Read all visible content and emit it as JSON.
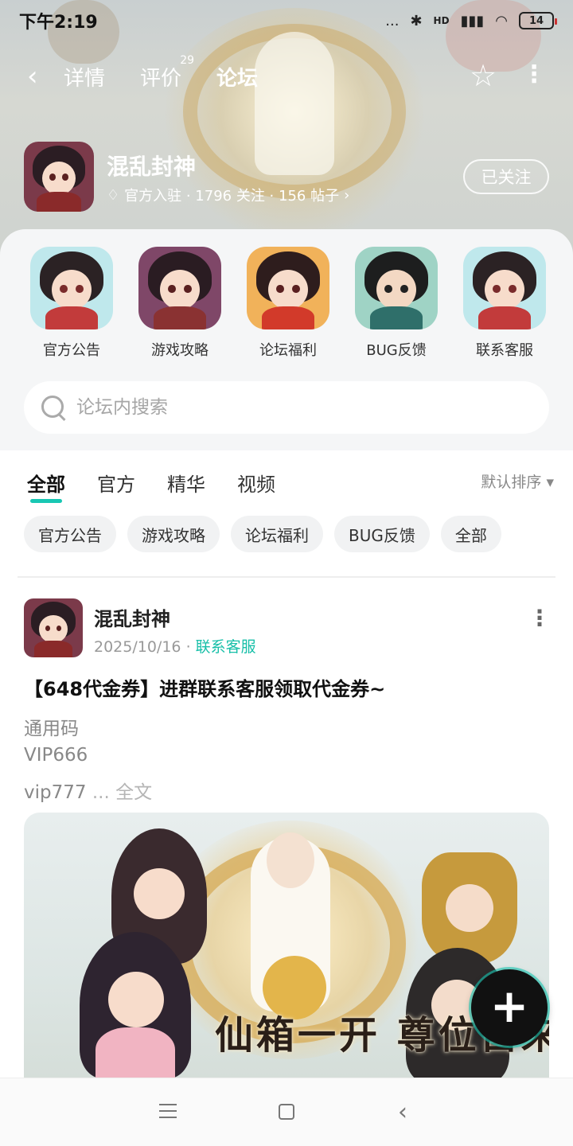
{
  "status_bar": {
    "time": "下午2:19",
    "signal": "...",
    "network": "HD",
    "battery": "14"
  },
  "nav": {
    "back_icon": "chevron-left-icon",
    "tabs": [
      {
        "label": "详情",
        "badge": ""
      },
      {
        "label": "评价",
        "badge": "29"
      },
      {
        "label": "论坛",
        "badge": ""
      }
    ],
    "active_tab": "论坛",
    "star_icon": "star-icon",
    "more_icon": "more-vertical-icon"
  },
  "game": {
    "title": "混乱封神",
    "meta": "官方入驻 · 1796 关注 · 156 帖子",
    "meta_chevron": "›",
    "follow_label": "已关注"
  },
  "categories": [
    {
      "label": "官方公告"
    },
    {
      "label": "游戏攻略"
    },
    {
      "label": "论坛福利"
    },
    {
      "label": "BUG反馈"
    },
    {
      "label": "联系客服"
    }
  ],
  "search": {
    "placeholder": "论坛内搜索",
    "value": ""
  },
  "filter_tabs": [
    {
      "label": "全部"
    },
    {
      "label": "官方"
    },
    {
      "label": "精华"
    },
    {
      "label": "视频"
    }
  ],
  "sort_label": "默认排序 ▾",
  "chips": [
    "官方公告",
    "游戏攻略",
    "论坛福利",
    "BUG反馈",
    "全部"
  ],
  "post": {
    "author": "混乱封神",
    "date": "2025/10/16",
    "separator": "·",
    "tag": "联系客服",
    "title": "【648代金券】进群联系客服领取代金券~",
    "lines": [
      "通用码",
      "VIP666",
      "vip777"
    ],
    "ellipsis": " ... ",
    "full_label": "全文",
    "banner_text": "仙箱一开 尊位自来"
  },
  "fab_label": "+",
  "colors": {
    "accent": "#18c7b3",
    "tag": "#17bfa8"
  }
}
